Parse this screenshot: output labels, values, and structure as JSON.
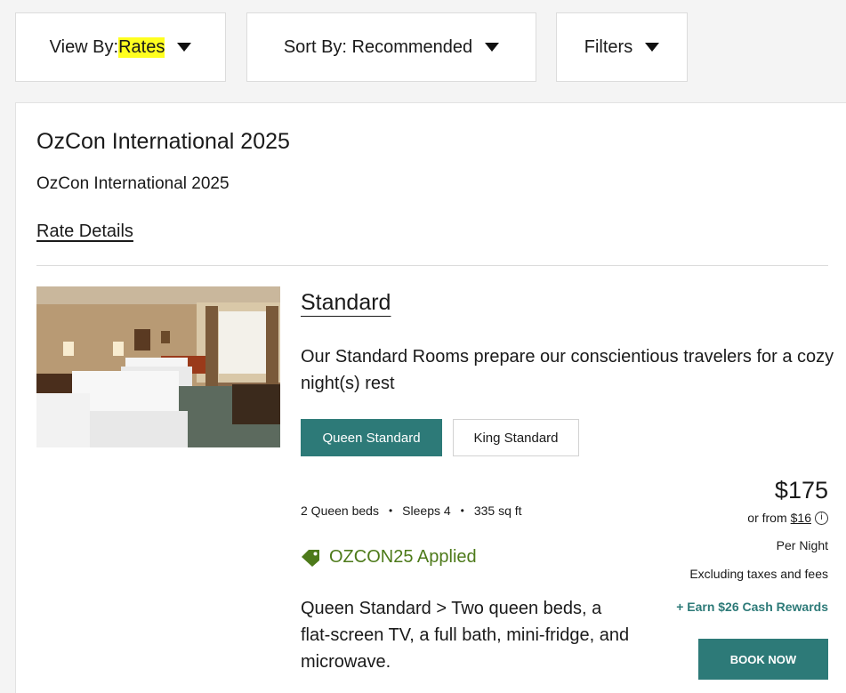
{
  "toolbar": {
    "view_by_label": "View By: ",
    "view_by_value": "Rates",
    "sort_by_label": "Sort By: Recommended",
    "filters_label": "Filters"
  },
  "rate": {
    "title": "OzCon International 2025",
    "subtitle": "OzCon International 2025",
    "details_link": "Rate Details"
  },
  "room": {
    "name": "Standard",
    "description": "Our Standard Rooms prepare our conscientious travelers for a cozy night(s) rest",
    "variants": [
      "Queen Standard",
      "King Standard"
    ],
    "selected_variant": "Queen Standard",
    "features": [
      "2 Queen beds",
      "Sleeps 4",
      "335 sq ft"
    ],
    "feature_separator": "•",
    "promo": "OZCON25 Applied",
    "long_description": "Queen Standard > Two queen beds, a flat-screen TV, a full bath, mini-fridge, and microwave."
  },
  "pricing": {
    "price": "$175",
    "from_prefix": "or from",
    "from_amount": "$16",
    "info_glyph": "i",
    "per_night": "Per Night",
    "excluding": "Excluding taxes and fees",
    "rewards": "+ Earn $26 Cash Rewards",
    "book_label": "BOOK NOW"
  },
  "icons": {
    "caret": "caret-down-icon",
    "promo": "tag-icon",
    "info": "info-icon"
  },
  "colors": {
    "accent": "#2d7a78",
    "promo": "#4d7a1a",
    "highlight": "#ffff1f"
  }
}
